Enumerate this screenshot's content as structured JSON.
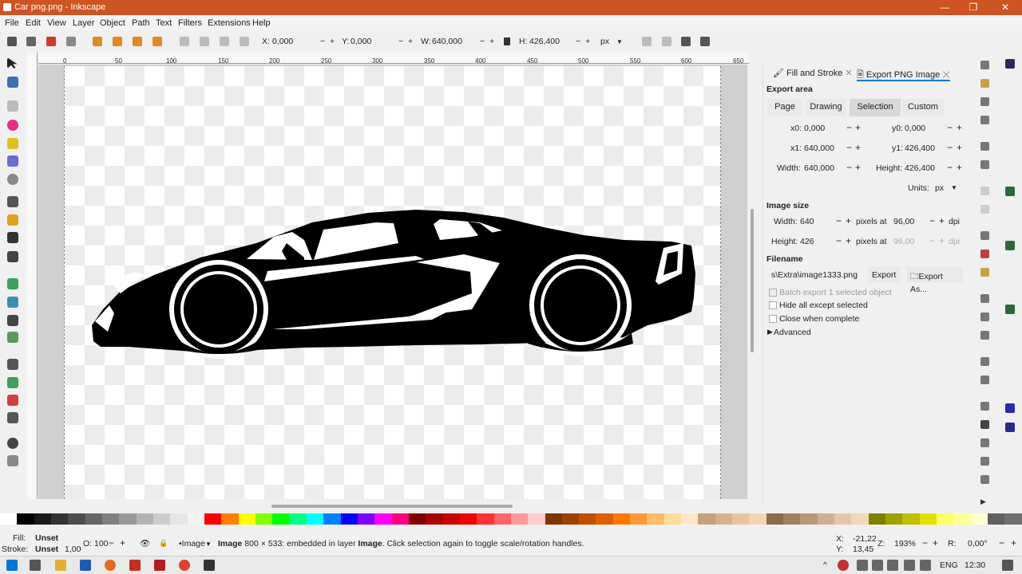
{
  "window": {
    "title": "Car png.png - Inkscape",
    "minimize": "—",
    "maximize": "❐",
    "close": "✕"
  },
  "menu": [
    "File",
    "Edit",
    "View",
    "Layer",
    "Object",
    "Path",
    "Text",
    "Filters",
    "Extensions",
    "Help"
  ],
  "toolbar": {
    "x_label": "X:",
    "x_value": "0,000",
    "y_label": "Y:",
    "y_value": "0,000",
    "w_label": "W:",
    "w_value": "640,000",
    "h_label": "H:",
    "h_value": "426,400",
    "unit": "px",
    "minus": "−",
    "plus": "+"
  },
  "ruler_top": [
    "0",
    "50",
    "100",
    "150",
    "200",
    "250",
    "300",
    "350",
    "400",
    "450",
    "500",
    "550",
    "600",
    "650"
  ],
  "dock": {
    "tab1": "Fill and Stroke",
    "tab2": "Export PNG Image",
    "export_area_title": "Export area",
    "area_buttons": [
      "Page",
      "Drawing",
      "Selection",
      "Custom"
    ],
    "active_area": "Selection",
    "x0_label": "x0:",
    "x0": "0,000",
    "y0_label": "y0:",
    "y0": "0,000",
    "x1_label": "x1:",
    "x1": "640,000",
    "y1_label": "y1:",
    "y1": "426,400",
    "width_label": "Width:",
    "width": "640,000",
    "height_label": "Height:",
    "height": "426,400",
    "units_label": "Units:",
    "units": "px",
    "image_size_title": "Image size",
    "img_width_label": "Width:",
    "img_width": "640",
    "img_height_label": "Height:",
    "img_height": "426",
    "pixels_at": "pixels at",
    "dpi1": "96,00",
    "dpi2": "96,00",
    "dpi_unit": "dpi",
    "filename_title": "Filename",
    "filename": "s\\Extra\\image1333.png",
    "export_btn": "Export",
    "export_as_btn": "Export As...",
    "batch_export": "Batch export 1 selected object",
    "hide_all": "Hide all except selected",
    "close_when": "Close when complete",
    "advanced": "Advanced"
  },
  "status": {
    "fill_label": "Fill:",
    "fill_value": "Unset",
    "stroke_label": "Stroke:",
    "stroke_value": "Unset",
    "stroke_width": "1,00",
    "opacity_label": "O:",
    "opacity": "100",
    "layer": "•Image",
    "message_bold": "Image",
    "message": " 800 × 533: embedded in layer ",
    "message_layer": "Image",
    "message_tail": ". Click selection again to toggle scale/rotation handles.",
    "coord_x_label": "X:",
    "coord_x": "-21,22",
    "coord_y_label": "Y:",
    "coord_y": "13,45",
    "zoom_label": "Z:",
    "zoom": "193%",
    "rot_label": "R:",
    "rotation": "0,00°"
  },
  "taskbar": {
    "lang": "ENG",
    "time": "12:30"
  },
  "colors": {
    "titlebar": "#cd5423",
    "accent": "#0078d4"
  }
}
